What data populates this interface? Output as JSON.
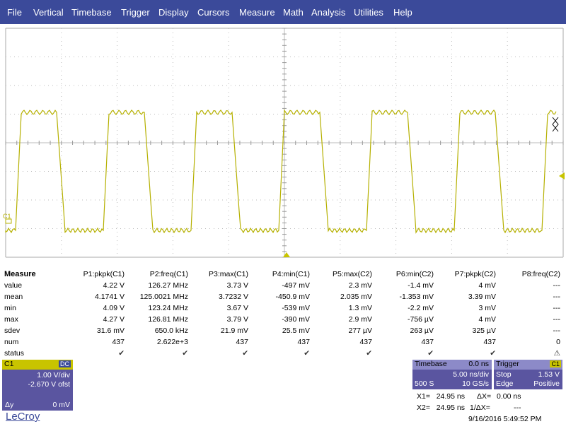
{
  "menu": [
    "File",
    "Vertical",
    "Timebase",
    "Trigger",
    "Display",
    "Cursors",
    "Measure",
    "Math",
    "Analysis",
    "Utilities",
    "Help"
  ],
  "channel_marker": "C1",
  "trace_color": "#c8c400",
  "measure": {
    "title": "Measure",
    "headers": [
      "P1:pkpk(C1)",
      "P2:freq(C1)",
      "P3:max(C1)",
      "P4:min(C1)",
      "P5:max(C2)",
      "P6:min(C2)",
      "P7:pkpk(C2)",
      "P8:freq(C2)"
    ],
    "rows": [
      {
        "label": "value",
        "cells": [
          "4.22 V",
          "126.27 MHz",
          "3.73 V",
          "-497 mV",
          "2.3 mV",
          "-1.4 mV",
          "4 mV",
          "---"
        ]
      },
      {
        "label": "mean",
        "cells": [
          "4.1741 V",
          "125.0021 MHz",
          "3.7232 V",
          "-450.9 mV",
          "2.035 mV",
          "-1.353 mV",
          "3.39 mV",
          "---"
        ]
      },
      {
        "label": "min",
        "cells": [
          "4.09 V",
          "123.24 MHz",
          "3.67 V",
          "-539 mV",
          "1.3 mV",
          "-2.2 mV",
          "3 mV",
          "---"
        ]
      },
      {
        "label": "max",
        "cells": [
          "4.27 V",
          "126.81 MHz",
          "3.79 V",
          "-390 mV",
          "2.9 mV",
          "-756 µV",
          "4 mV",
          "---"
        ]
      },
      {
        "label": "sdev",
        "cells": [
          "31.6 mV",
          "650.0 kHz",
          "21.9 mV",
          "25.5 mV",
          "277 µV",
          "263 µV",
          "325 µV",
          "---"
        ]
      },
      {
        "label": "num",
        "cells": [
          "437",
          "2.622e+3",
          "437",
          "437",
          "437",
          "437",
          "437",
          "0"
        ]
      }
    ],
    "status_label": "status",
    "status_icons": [
      "check-icon",
      "check-icon",
      "check-icon",
      "check-icon",
      "check-icon",
      "check-icon",
      "check-icon",
      "warning-icon"
    ]
  },
  "c1": {
    "name": "C1",
    "coupling": "DC",
    "vdiv": "1.00 V/div",
    "offset": "-2.670 V ofst",
    "dy_label": "Δy",
    "dy_value": "0 mV"
  },
  "timebase": {
    "title": "Timebase",
    "delay": "0.0 ns",
    "tdiv": "5.00 ns/div",
    "samples": "500 S",
    "rate": "10 GS/s"
  },
  "trigger": {
    "title": "Trigger",
    "channel": "C1",
    "mode": "Stop",
    "level": "1.53 V",
    "type": "Edge",
    "slope": "Positive"
  },
  "cursors": {
    "x1_label": "X1=",
    "x1": "24.95 ns",
    "dx_label": "ΔX=",
    "dx": "0.00 ns",
    "x2_label": "X2=",
    "x2": "24.95 ns",
    "inv_label": "1/ΔX=",
    "inv": "---"
  },
  "timestamp": "9/16/2016 5:49:52 PM",
  "brand": "LeCroy"
}
